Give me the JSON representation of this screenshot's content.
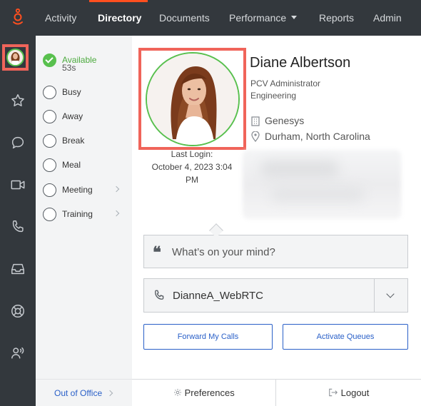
{
  "topnav": {
    "items": [
      "Activity",
      "Directory",
      "Documents",
      "Performance",
      "Reports",
      "Admin"
    ],
    "active": "Directory",
    "accent": "#ff4f1f"
  },
  "rail": {
    "icons": [
      "avatar",
      "star-icon",
      "chat-icon",
      "video-icon",
      "phone-icon",
      "inbox-icon",
      "lifebuoy-icon",
      "person-voice-icon"
    ]
  },
  "presence": {
    "statuses": [
      {
        "label": "Available",
        "checked": true
      },
      {
        "label": "Busy"
      },
      {
        "label": "Away"
      },
      {
        "label": "Break"
      },
      {
        "label": "Meal"
      },
      {
        "label": "Meeting",
        "submenu": true
      },
      {
        "label": "Training",
        "submenu": true
      }
    ],
    "duration": "53s",
    "out_of_office": "Out of Office"
  },
  "profile": {
    "name": "Diane Albertson",
    "title": "PCV Administrator",
    "department": "Engineering",
    "organization": "Genesys",
    "location": "Durham, North Carolina",
    "last_login_label": "Last Login:",
    "last_login_value": "October 4, 2023 3:04 PM",
    "status_color": "#58c04e"
  },
  "status_message": {
    "placeholder": "What’s on your mind?"
  },
  "station": {
    "value": "DianneA_WebRTC"
  },
  "buttons": {
    "forward": "Forward My Calls",
    "queues": "Activate Queues"
  },
  "footer": {
    "preferences": "Preferences",
    "logout": "Logout"
  },
  "highlight_color": "#f0645a"
}
